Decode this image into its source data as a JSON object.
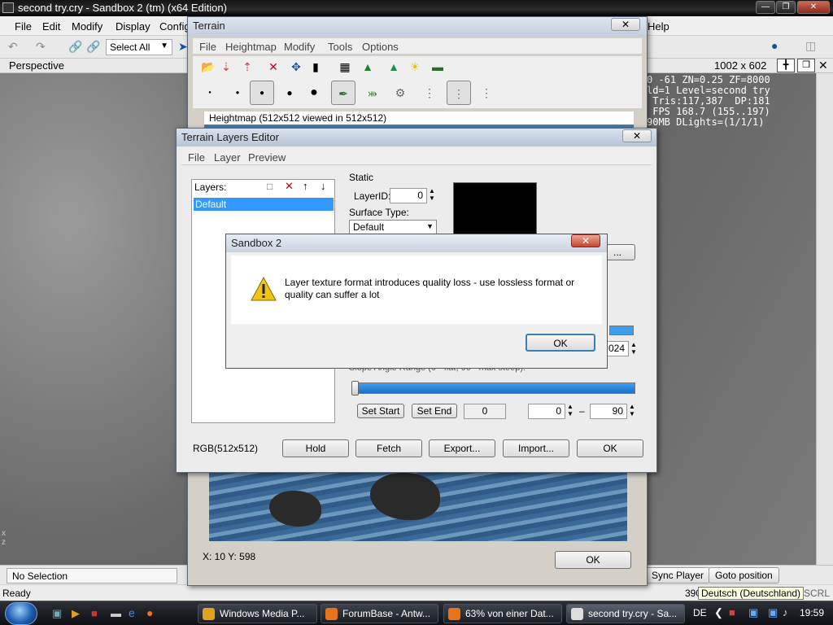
{
  "app": {
    "title": "second try.cry - Sandbox 2 (tm) (x64 Edition)",
    "menu": [
      "File",
      "Edit",
      "Modify",
      "Display",
      "Config",
      "Help"
    ],
    "select_all": "Select All",
    "viewport_label": "Perspective",
    "resolution": "1002 x 602",
    "stats": "0 -61 ZN=0.25 ZF=8000\nld=1 Level=second try\n Tris:117,387  DP:181\n FPS 168.7 (155..197)\n90MB DLights=(1/1/1)",
    "selection": "No Selection",
    "sync_player": "Sync Player",
    "goto_position": "Goto position",
    "status": "Ready",
    "status_right": "390",
    "scrl": "SCRL"
  },
  "terrain": {
    "title": "Terrain",
    "menu": [
      "File",
      "Heightmap",
      "Modify",
      "Tools",
      "Options"
    ],
    "heightmap_label": "Heightmap (512x512 viewed in 512x512)",
    "coords": "X: 10 Y: 598",
    "ok": "OK"
  },
  "layers": {
    "title": "Terrain Layers Editor",
    "menu": [
      "File",
      "Layer",
      "Preview"
    ],
    "layers_label": "Layers:",
    "default_layer": "Default",
    "static_label": "Static",
    "layer_id_label": "LayerID:",
    "layer_id": "0",
    "surface_type_label": "Surface Type:",
    "surface_type": "Default",
    "slope_label": "Slope Angle Range (0 - flat, 90 - max steep):",
    "set_start": "Set Start",
    "set_end": "Set End",
    "slope_value": "0",
    "slope_min": "0",
    "slope_max": "90",
    "partial_value": "024",
    "browse": "...",
    "rgb": "RGB(512x512)",
    "buttons": [
      "Hold",
      "Fetch",
      "Export...",
      "Import...",
      "OK"
    ]
  },
  "msgbox": {
    "title": "Sandbox 2",
    "message": "Layer texture format introduces quality loss - use lossless format or quality can suffer a lot",
    "ok": "OK"
  },
  "taskbar": {
    "tasks": [
      "Windows Media P...",
      "ForumBase - Antw...",
      "63% von einer Dat...",
      "second try.cry - Sa..."
    ],
    "lang": "DE",
    "lang_tooltip": "Deutsch (Deutschland)",
    "clock": "19:59"
  },
  "colors": {
    "selection": "#3399ff",
    "slider": "#1f6fc8",
    "warning": "#f2c318"
  }
}
